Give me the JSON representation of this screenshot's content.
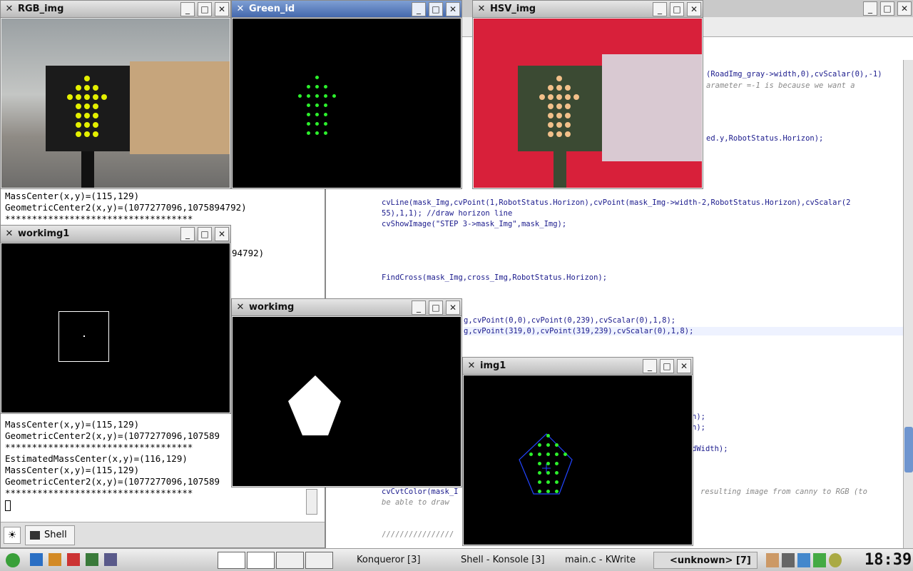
{
  "windows": {
    "rgb": {
      "title": "RGB_img"
    },
    "green": {
      "title": "Green_id"
    },
    "hsv": {
      "title": "HSV_img"
    },
    "workimg1": {
      "title": "workimg1"
    },
    "workimg": {
      "title": "workimg"
    },
    "img1": {
      "title": "img1"
    }
  },
  "konsole": {
    "lines_top": [
      "MassCenter(x,y)=(115,129)",
      "GeometricCenter2(x,y)=(1077277096,1075894792)",
      "***********************************"
    ],
    "lines_bottom": [
      "MassCenter(x,y)=(115,129)",
      "GeometricCenter2(x,y)=(1077277096,107589",
      "***********************************",
      "EstimatedMassCenter(x,y)=(116,129)",
      "MassCenter(x,y)=(115,129)",
      "GeometricCenter2(x,y)=(1077277096,107589",
      "***********************************"
    ],
    "fragments": [
      "94792)",
      "94792)"
    ],
    "tab_label": "Shell"
  },
  "kwrite": {
    "code_lines": [
      "(RoadImg_gray->width,0),cvScalar(0),-1)",
      "arameter =-1 is because we want a",
      "ed.y,RobotStatus.Horizon);",
      "cvLine(mask_Img,cvPoint(1,RobotStatus.Horizon),cvPoint(mask_Img->width-2,RobotStatus.Horizon),cvScalar(2",
      "55),1,1); //draw horizon line",
      "cvShowImage(\"STEP 3->mask_Img\",mask_Img);",
      "FindCross(mask_Img,cross_Img,RobotStatus.Horizon);",
      "g,cvPoint(0,0),cvPoint(0,239),cvScalar(0),1,8);",
      "g,cvPoint(319,0),cvPoint(319,239),cvScalar(0),1,8);",
      "n);",
      "n);",
      "dWidth);",
      "cvCvtColor(mask_I",
      "resulting image from canny to RGB (to",
      "be able to draw",
      "////////////////"
    ]
  },
  "taskbar": {
    "tasks": [
      "Konqueror [3]",
      "Shell - Konsole [3]",
      "main.c - KWrite",
      "<unknown> [7]"
    ],
    "clock": "18:39"
  }
}
